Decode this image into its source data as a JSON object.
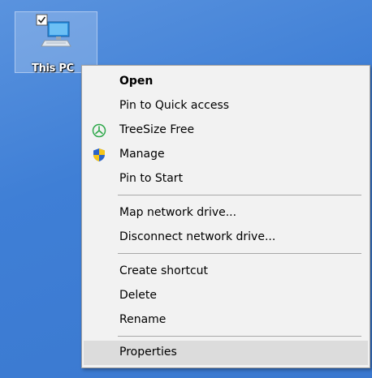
{
  "desktop": {
    "icon_label": "This PC"
  },
  "menu": {
    "items": [
      {
        "label": "Open"
      },
      {
        "label": "Pin to Quick access"
      },
      {
        "label": "TreeSize Free",
        "icon": "treesize-icon"
      },
      {
        "label": "Manage",
        "icon": "uac-shield-icon"
      },
      {
        "label": "Pin to Start"
      },
      {
        "label": "Map network drive..."
      },
      {
        "label": "Disconnect network drive..."
      },
      {
        "label": "Create shortcut"
      },
      {
        "label": "Delete"
      },
      {
        "label": "Rename"
      },
      {
        "label": "Properties"
      }
    ]
  },
  "colors": {
    "desktop_bg": "#3f7fd6",
    "menu_bg": "#f2f2f2",
    "highlight": "#dcdcdc",
    "treesize_green": "#2ea84a"
  }
}
